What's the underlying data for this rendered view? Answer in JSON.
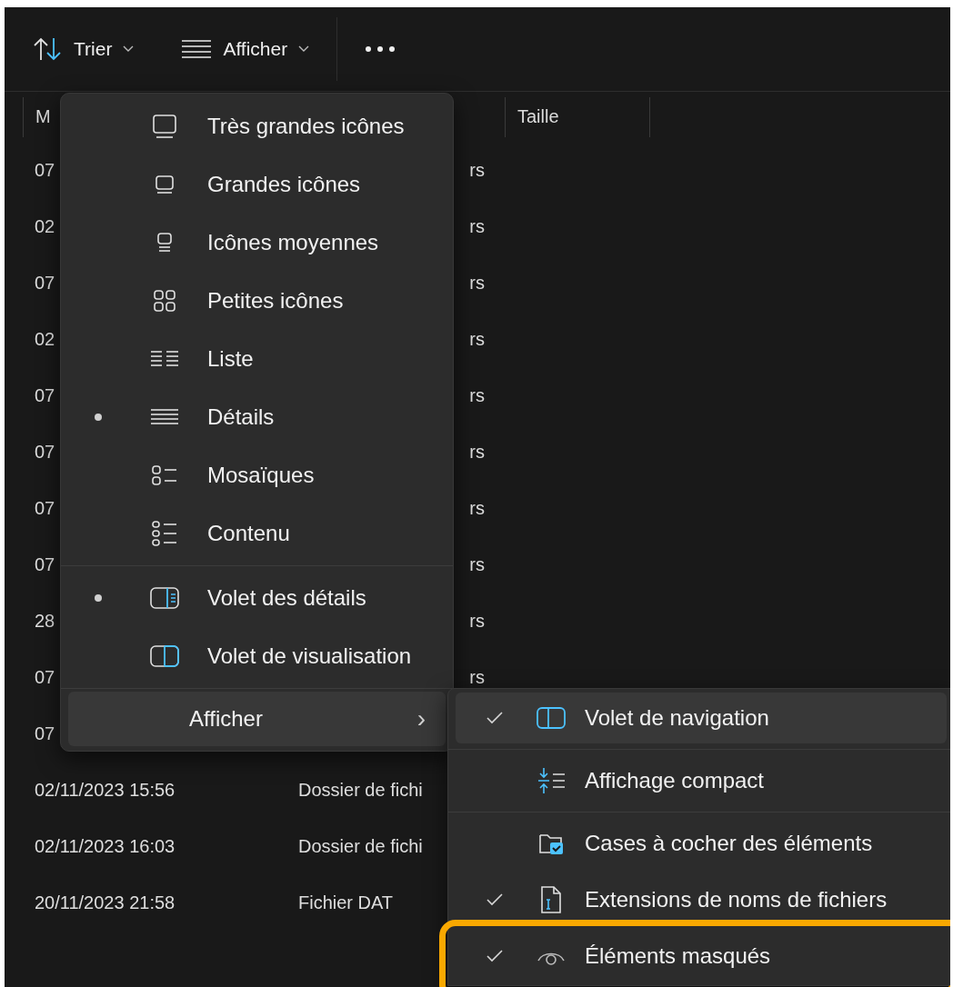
{
  "toolbar": {
    "buttons": [
      {
        "label": "Trier",
        "kind": "sort"
      },
      {
        "label": "Afficher",
        "kind": "view"
      }
    ]
  },
  "table": {
    "columns": [
      "M",
      "",
      "Taille"
    ],
    "rows": [
      {
        "date": "07",
        "type": "rs",
        "type_cut": true
      },
      {
        "date": "02",
        "type": "rs",
        "type_cut": true
      },
      {
        "date": "07",
        "type": "rs",
        "type_cut": true
      },
      {
        "date": "02",
        "type": "rs",
        "type_cut": true
      },
      {
        "date": "07",
        "type": "rs",
        "type_cut": true
      },
      {
        "date": "07",
        "type": "rs",
        "type_cut": true
      },
      {
        "date": "07",
        "type": "rs",
        "type_cut": true
      },
      {
        "date": "07",
        "type": "rs",
        "type_cut": true
      },
      {
        "date": "28",
        "type": "rs",
        "type_cut": true
      },
      {
        "date": "07",
        "type": "rs",
        "type_cut": true
      },
      {
        "date": "07"
      },
      {
        "date": "02/11/2023 15:56",
        "type": "Dossier de fichi",
        "type_cut": false
      },
      {
        "date": "02/11/2023 16:03",
        "type": "Dossier de fichi",
        "type_cut": false
      },
      {
        "date": "20/11/2023 21:58",
        "type": "Fichier DAT",
        "type_cut": false
      }
    ]
  },
  "view_menu": {
    "groups": [
      [
        {
          "label": "Très grandes icônes",
          "selected": false
        },
        {
          "label": "Grandes icônes",
          "selected": false
        },
        {
          "label": "Icônes moyennes",
          "selected": false
        },
        {
          "label": "Petites icônes",
          "selected": false
        },
        {
          "label": "Liste",
          "selected": false
        },
        {
          "label": "Détails",
          "selected": true
        },
        {
          "label": "Mosaïques",
          "selected": false
        },
        {
          "label": "Contenu",
          "selected": false
        }
      ],
      [
        {
          "label": "Volet des détails",
          "selected": true
        },
        {
          "label": "Volet de visualisation",
          "selected": false
        }
      ]
    ],
    "submenu_item": {
      "label": "Afficher",
      "chevron": "›",
      "highlighted": true
    }
  },
  "show_submenu": {
    "groups": [
      [
        {
          "label": "Volet de navigation",
          "checked": true,
          "highlighted": true
        }
      ],
      [
        {
          "label": "Affichage compact",
          "checked": false,
          "highlighted": false
        }
      ],
      [
        {
          "label": "Cases à cocher des éléments",
          "checked": false,
          "highlighted": false
        },
        {
          "label": "Extensions de noms de fichiers",
          "checked": true,
          "highlighted": false
        },
        {
          "label": "Éléments masqués",
          "checked": true,
          "highlighted": false,
          "marked": true
        }
      ]
    ]
  }
}
